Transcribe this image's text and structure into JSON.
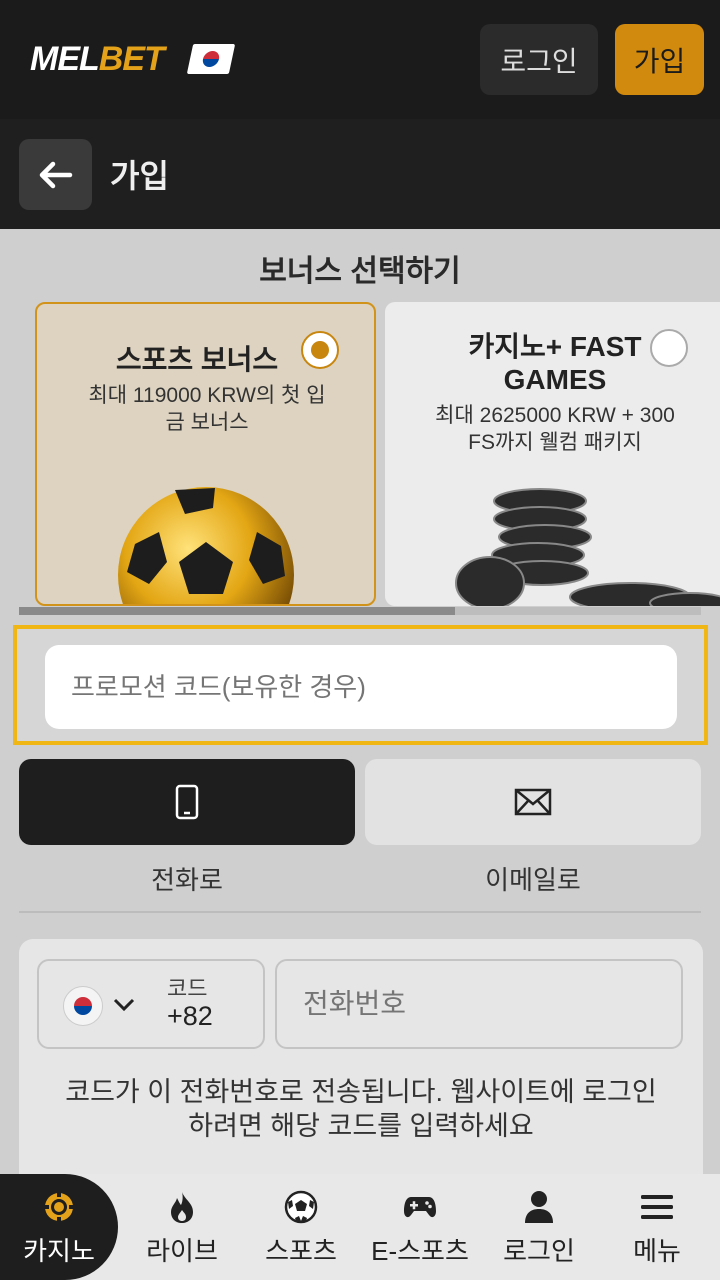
{
  "header": {
    "logo_mel": "MEL",
    "logo_bet": "BET",
    "login_label": "로그인",
    "join_label": "가입"
  },
  "subheader": {
    "title": "가입"
  },
  "bonus": {
    "section_title": "보너스 선택하기",
    "cards": [
      {
        "title": "스포츠 보너스",
        "description_line1": "최대 119000 KRW의 첫 입",
        "description_line2": "금 보너스",
        "selected": true
      },
      {
        "title_line1": "카지노+ FAST",
        "title_line2": "GAMES",
        "description_line1": "최대 2625000 KRW + 300",
        "description_line2": "FS까지 웰컴 패키지",
        "selected": false
      }
    ]
  },
  "promo": {
    "placeholder": "프로모션 코드(보유한 경우)"
  },
  "registration_tabs": [
    {
      "label": "전화로",
      "icon": "phone-icon",
      "active": true
    },
    {
      "label": "이메일로",
      "icon": "envelope-icon",
      "active": false
    }
  ],
  "phone_form": {
    "code_label": "코드",
    "code_value": "+82",
    "phone_placeholder": "전화번호",
    "hint_line1": "코드가 이 전화번호로 전송됩니다. 웹사이트에 로그인",
    "hint_line2": "하려면 해당 코드를 입력하세요"
  },
  "bottom_nav": [
    {
      "label": "카지노",
      "icon": "casino-chip-icon",
      "active": true
    },
    {
      "label": "라이브",
      "icon": "flame-icon",
      "active": false
    },
    {
      "label": "스포츠",
      "icon": "soccer-ball-icon",
      "active": false
    },
    {
      "label": "E-스포츠",
      "icon": "gamepad-icon",
      "active": false
    },
    {
      "label": "로그인",
      "icon": "user-icon",
      "active": false
    },
    {
      "label": "메뉴",
      "icon": "hamburger-icon",
      "active": false
    }
  ],
  "colors": {
    "accent": "#d28a0e",
    "promo_border": "#f0b614",
    "dark": "#1b1b1b"
  }
}
